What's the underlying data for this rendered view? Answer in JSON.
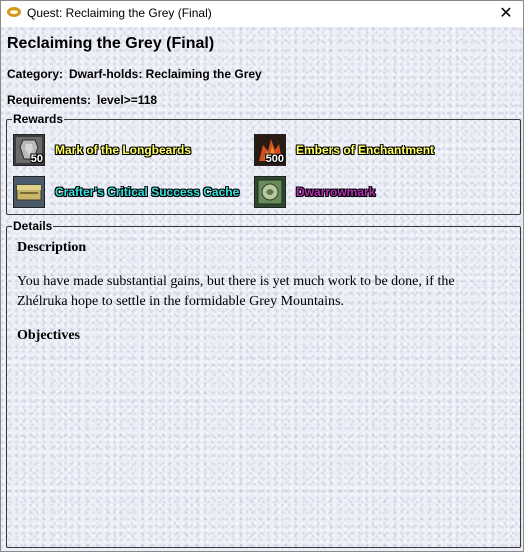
{
  "window": {
    "title": "Quest: Reclaiming the Grey (Final)",
    "close_glyph": "✕"
  },
  "quest": {
    "name": "Reclaiming the Grey (Final)",
    "category_label": "Category:",
    "category_value": "Dwarf-holds: Reclaiming the Grey",
    "requirements_label": "Requirements:",
    "requirements_value": "level>=118"
  },
  "rewards": {
    "legend": "Rewards",
    "items": [
      {
        "label": "Mark of the Longbeards",
        "qty": "50",
        "color": "#ffff66",
        "icon": "longbeard-mark-icon"
      },
      {
        "label": "Embers of Enchantment",
        "qty": "500",
        "color": "#ffff66",
        "icon": "ember-icon"
      },
      {
        "label": "Crafter's Critical Success Cache",
        "qty": "",
        "color": "#33e0e0",
        "icon": "cache-icon"
      },
      {
        "label": "Dwarrowmark",
        "qty": "",
        "color": "#b030b0",
        "icon": "dwarrowmark-icon"
      }
    ]
  },
  "details": {
    "legend": "Details",
    "description_heading": "Description",
    "description_text": "You have made substantial gains, but there is yet much work to be done, if the Zhélruka hope to settle in the formidable Grey Mountains.",
    "objectives_heading": "Objectives"
  }
}
